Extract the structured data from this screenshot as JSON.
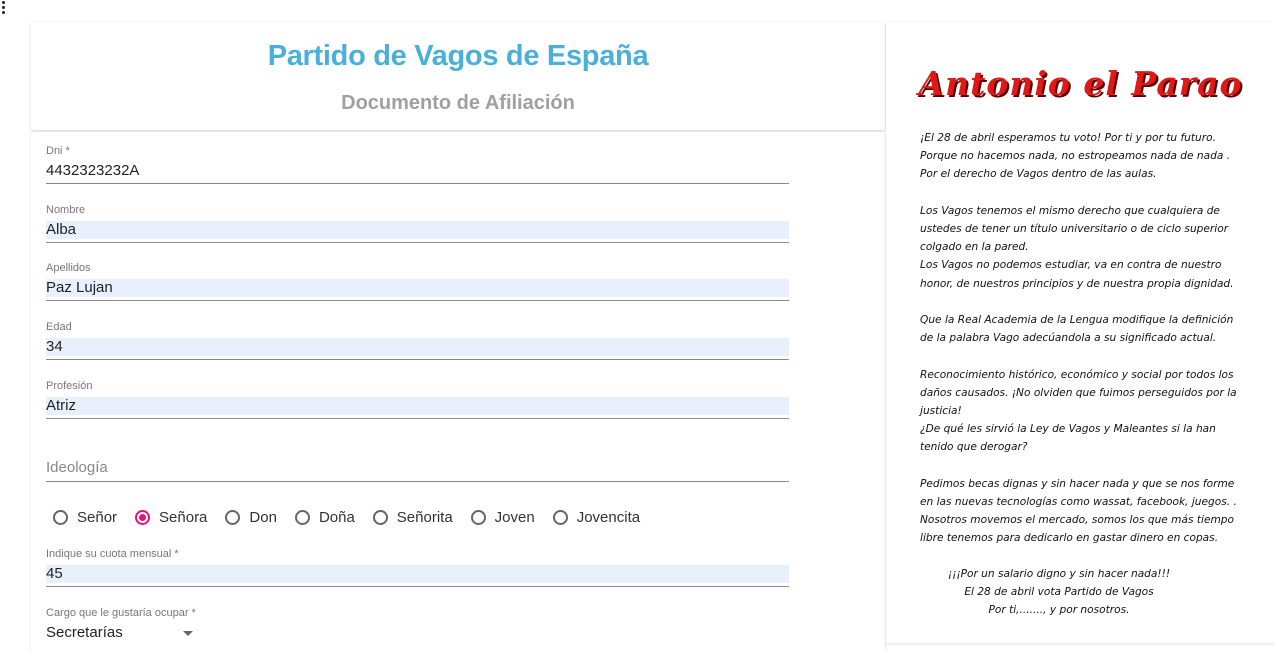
{
  "header": {
    "title": "Partido de Vagos de España",
    "subtitle": "Documento de Afiliación"
  },
  "form": {
    "dni": {
      "label": "Dni *",
      "value": "4432323232A"
    },
    "nombre": {
      "label": "Nombre",
      "value": "Alba"
    },
    "apellidos": {
      "label": "Apellidos",
      "value": "Paz Lujan"
    },
    "edad": {
      "label": "Edad",
      "value": "34"
    },
    "profesion": {
      "label": "Profesión",
      "value": "Atriz"
    },
    "ideologia": {
      "placeholder": "Ideología"
    },
    "tratamiento": {
      "options": [
        "Señor",
        "Señora",
        "Don",
        "Doña",
        "Señorita",
        "Joven",
        "Jovencita"
      ],
      "selected": "Señora"
    },
    "cuota": {
      "label": "Indique su cuota mensual *",
      "value": "45"
    },
    "cargo": {
      "label": "Cargo que le gustaría ocupar *",
      "value": "Secretarías"
    }
  },
  "flyer": {
    "candidate": "Antonio el Parao",
    "paragraphs": [
      [
        "¡El 28 de abril esperamos tu voto! Por ti y por tu futuro.",
        "Porque no hacemos nada, no estropeamos nada de nada .",
        "Por el derecho de Vagos dentro de las aulas."
      ],
      [
        "Los Vagos tenemos el mismo derecho que cualquiera de",
        "ustedes de tener un título universitario o de ciclo superior",
        "colgado en la pared.",
        "Los Vagos no podemos estudiar, va en contra de nuestro",
        "honor, de nuestros principios y de nuestra propia dignidad."
      ],
      [
        "Que la Real Academia de la Lengua modifique la definición",
        " de la palabra Vago adecúandola a su significado actual."
      ],
      [
        "Reconocimiento histórico, económico y social por todos los",
        "daños causados. ¡No olviden que fuimos perseguidos por la",
        "justicia!",
        "¿De qué les sirvió la Ley de Vagos y Maleantes si la han",
        "tenido que derogar?"
      ],
      [
        "Pedimos becas dignas y sin hacer nada y que se nos forme",
        "en las nuevas tecnologías como wassat, facebook, juegos. .",
        "Nosotros movemos el mercado, somos los que más tiempo",
        "libre tenemos para dedicarlo en gastar dinero en copas."
      ]
    ],
    "closing": [
      "¡¡¡Por un salario digno y sin hacer nada!!!",
      "El 28 de abril vota Partido de Vagos",
      "Por ti,......., y por nosotros."
    ]
  }
}
